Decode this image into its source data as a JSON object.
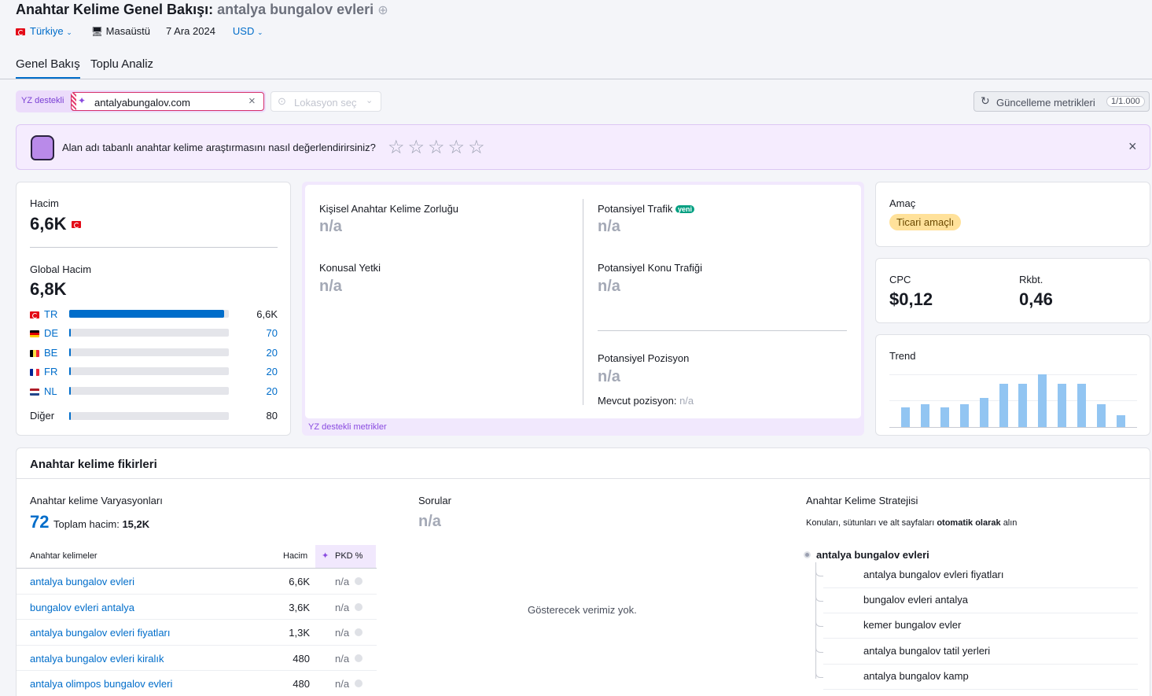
{
  "header": {
    "title": "Anahtar Kelime Genel Bakışı:",
    "keyword": "antalya bungalov evleri",
    "country": "Türkiye",
    "device": "Masaüstü",
    "date": "7 Ara 2024",
    "currency": "USD"
  },
  "tabs": [
    {
      "label": "Genel Bakış",
      "active": true
    },
    {
      "label": "Toplu Analiz",
      "active": false
    }
  ],
  "toolbar": {
    "ai_badge": "YZ destekli",
    "domain_input": "antalyabungalov.com",
    "location_placeholder": "Lokasyon seç",
    "update_label": "Güncelleme metrikleri",
    "update_count": "1/1.000"
  },
  "feedback": {
    "question": "Alan adı tabanlı anahtar kelime araştırmasını nasıl değerlendirirsiniz?",
    "stars": 5
  },
  "volume": {
    "label": "Hacim",
    "value": "6,6K",
    "global_label": "Global Hacim",
    "global_value": "6,8K",
    "countries": [
      {
        "code": "TR",
        "value": "6,6K",
        "share": 0.97
      },
      {
        "code": "DE",
        "value": "70",
        "share": 0.012
      },
      {
        "code": "BE",
        "value": "20",
        "share": 0.01
      },
      {
        "code": "FR",
        "value": "20",
        "share": 0.01
      },
      {
        "code": "NL",
        "value": "20",
        "share": 0.01
      }
    ],
    "other_label": "Diğer",
    "other_value": "80",
    "other_share": 0.012
  },
  "metrics": {
    "pkd_label": "Kişisel Anahtar Kelime Zorluğu",
    "pkd_value": "n/a",
    "authority_label": "Konusal Yetki",
    "authority_value": "n/a",
    "traffic_label": "Potansiyel Trafik",
    "new_badge": "yeni",
    "traffic_value": "n/a",
    "topic_traffic_label": "Potansiyel Konu Trafiği",
    "topic_traffic_value": "n/a",
    "position_label": "Potansiyel Pozisyon",
    "position_value": "n/a",
    "current_position_label": "Mevcut pozisyon:",
    "current_position_value": "n/a",
    "footer": "YZ destekli metrikler"
  },
  "intent": {
    "label": "Amaç",
    "value": "Ticari amaçlı"
  },
  "cpc": {
    "label": "CPC",
    "value": "$0,12",
    "comp_label": "Rkbt.",
    "comp_value": "0,46"
  },
  "trend": {
    "label": "Trend",
    "values": [
      0.29,
      0.34,
      0.29,
      0.34,
      0.43,
      0.65,
      0.65,
      0.79,
      0.65,
      0.65,
      0.34,
      0.18
    ]
  },
  "ideas": {
    "title": "Anahtar kelime fikirleri",
    "variations_label": "Anahtar kelime Varyasyonları",
    "variations_count": "72",
    "total_label": "Toplam hacim:",
    "total_value": "15,2K",
    "table_headers": {
      "keyword": "Anahtar kelimeler",
      "volume": "Hacim",
      "pkd": "PKD %"
    },
    "rows": [
      {
        "keyword": "antalya bungalov evleri",
        "volume": "6,6K",
        "pkd": "n/a"
      },
      {
        "keyword": "bungalov evleri antalya",
        "volume": "3,6K",
        "pkd": "n/a"
      },
      {
        "keyword": "antalya bungalov evleri fiyatları",
        "volume": "1,3K",
        "pkd": "n/a"
      },
      {
        "keyword": "antalya bungalov evleri kiralık",
        "volume": "480",
        "pkd": "n/a"
      },
      {
        "keyword": "antalya olimpos bungalov evleri",
        "volume": "480",
        "pkd": "n/a"
      }
    ],
    "questions_label": "Sorular",
    "questions_value": "n/a",
    "no_data": "Gösterecek verimiz yok.",
    "strategy_label": "Anahtar Kelime Stratejisi",
    "strategy_desc_pre": "Konuları, sütunları ve alt sayfaları",
    "strategy_desc_bold": "otomatik olarak",
    "strategy_desc_post": "alın",
    "strategy_root": "antalya bungalov evleri",
    "strategy_items": [
      "antalya bungalov evleri fiyatları",
      "bungalov evleri antalya",
      "kemer bungalov evler",
      "antalya bungalov tatil yerleri",
      "antalya bungalov kamp"
    ]
  }
}
